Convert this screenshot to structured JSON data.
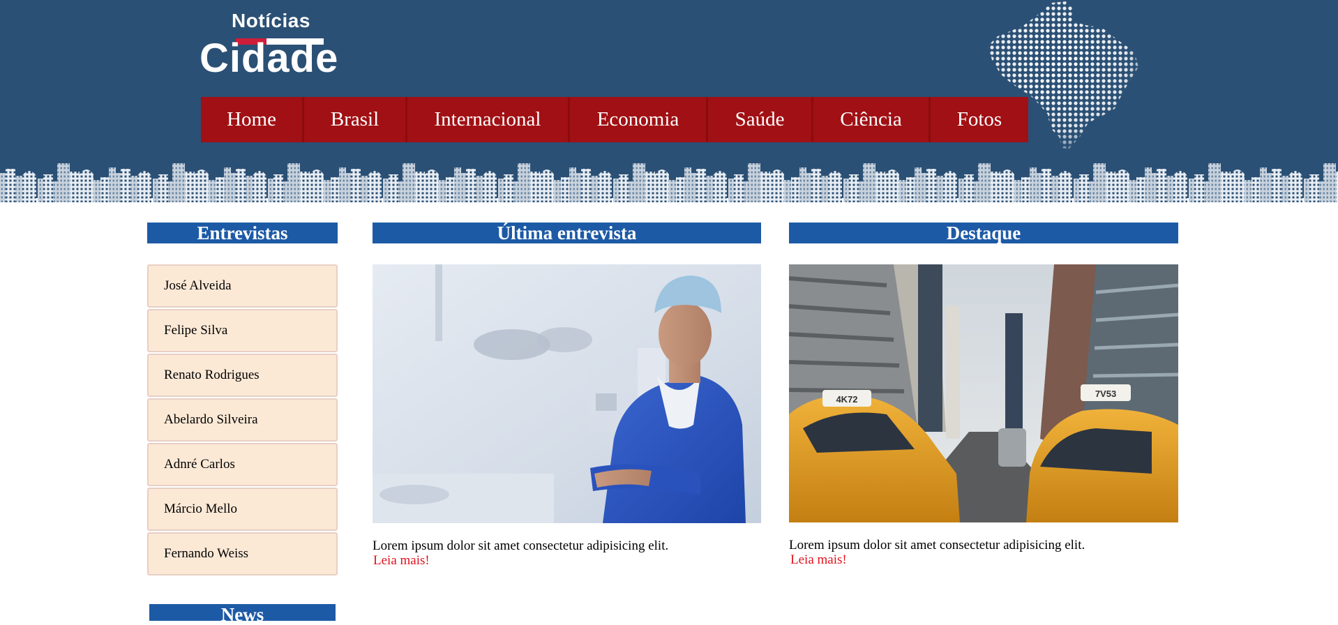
{
  "logo": {
    "top_text": "Notícias",
    "main_text": "Cidade"
  },
  "nav": {
    "items": [
      "Home",
      "Brasil",
      "Internacional",
      "Economia",
      "Saúde",
      "Ciência",
      "Fotos"
    ]
  },
  "colors": {
    "header_bg": "#2b5075",
    "nav_bg": "#a11014",
    "section_header_bg": "#1d5aa6",
    "list_item_bg": "#fbe9d6",
    "link_color": "#e0121d"
  },
  "sidebar": {
    "title": "Entrevistas",
    "items": [
      "José Alveida",
      "Felipe Silva",
      "Renato Rodrigues",
      "Abelardo Silveira",
      "Adnré Carlos",
      "Márcio Mello",
      "Fernando Weiss"
    ],
    "news_title": "News"
  },
  "latest": {
    "title": "Última entrevista",
    "image": "doctor-photo",
    "text": "Lorem ipsum dolor sit amet consectetur adipisicing elit.",
    "link": "Leia mais!"
  },
  "featured": {
    "title": "Destaque",
    "image": "taxi-street-photo",
    "text": "Lorem ipsum dolor sit amet consectetur adipisicing elit.",
    "link": "Leia mais!",
    "taxi_left_sign": "4K72",
    "taxi_right_sign": "7V53"
  }
}
